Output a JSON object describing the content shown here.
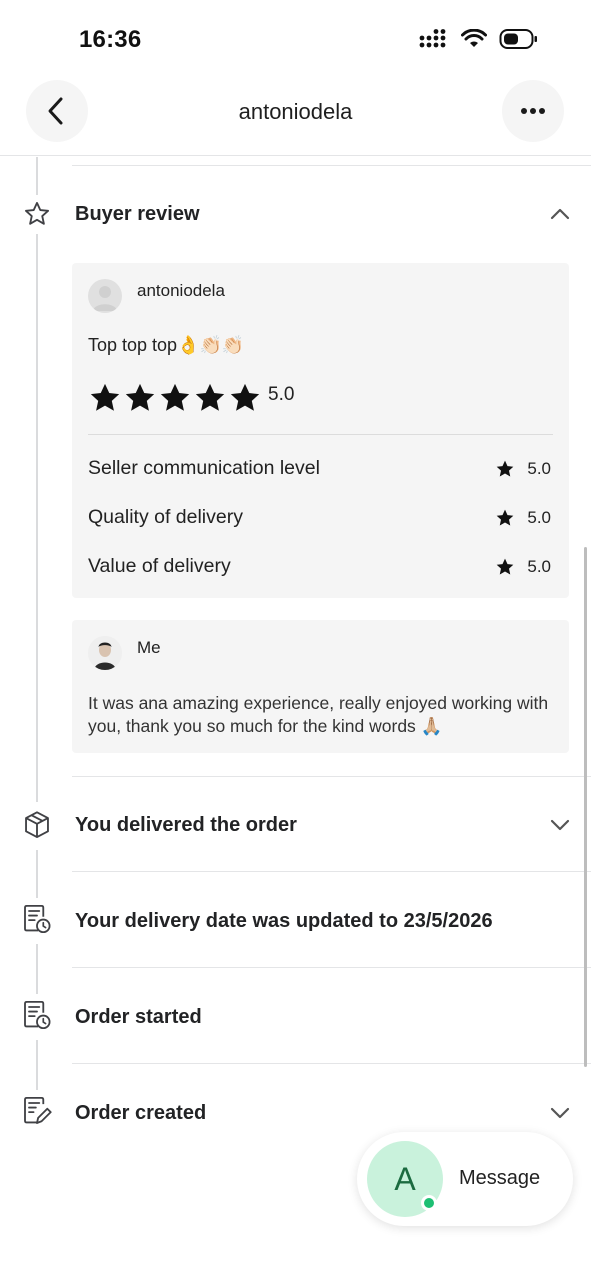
{
  "status_bar": {
    "time": "16:36"
  },
  "header": {
    "title": "antoniodela"
  },
  "timeline": {
    "buyer_review": {
      "title": "Buyer review",
      "reviewer": "antoniodela",
      "text": "Top top top👌👏🏻👏🏻",
      "overall_rating": "5.0",
      "stars": 5,
      "criteria": [
        {
          "label": "Seller communication level",
          "value": "5.0"
        },
        {
          "label": "Quality of delivery",
          "value": "5.0"
        },
        {
          "label": "Value of delivery",
          "value": "5.0"
        }
      ],
      "reply": {
        "name": "Me",
        "text": "It was ana amazing experience, really enjoyed working with you, thank you so much for the kind words 🙏🏼"
      }
    },
    "delivered": {
      "title": "You delivered the order"
    },
    "delivery_date": {
      "title": "Your delivery date was updated to 23/5/2026"
    },
    "order_started": {
      "title": "Order started"
    },
    "order_created": {
      "title": "Order created"
    }
  },
  "message_button": {
    "avatar_letter": "A",
    "label": "Message"
  },
  "colors": {
    "accent_green": "#1dbf73",
    "avatar_bg": "#c9f2dc",
    "card_bg": "#f5f5f5"
  }
}
